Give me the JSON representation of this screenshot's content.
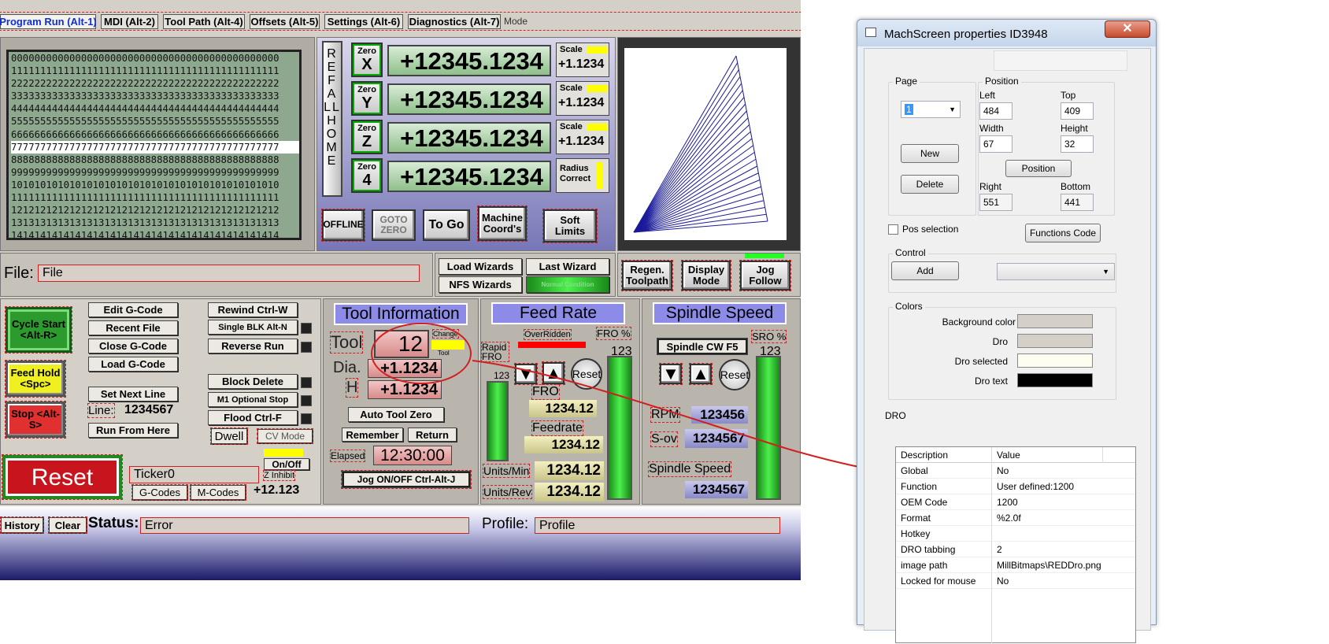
{
  "tabs": [
    {
      "label": "Program Run (Alt-1)",
      "active": true
    },
    {
      "label": "MDI (Alt-2)"
    },
    {
      "label": "Tool Path (Alt-4)"
    },
    {
      "label": "Offsets (Alt-5)"
    },
    {
      "label": "Settings (Alt-6)"
    },
    {
      "label": "Diagnostics (Alt-7)"
    }
  ],
  "mode_label": "Mode",
  "gcode_lines": [
    "0000000000000000000000000000000000000000000000",
    "1111111111111111111111111111111111111111111111",
    "2222222222222222222222222222222222222222222222",
    "3333333333333333333333333333333333333333333333",
    "4444444444444444444444444444444444444444444444",
    "5555555555555555555555555555555555555555555555",
    "6666666666666666666666666666666666666666666666",
    "7777777777777777777777777777777777777777777777",
    "8888888888888888888888888888888888888888888888",
    "9999999999999999999999999999999999999999999999",
    "1010101010101010101010101010101010101010101010",
    "1111111111111111111111111111111111111111111111",
    "1212121212121212121212121212121212121212121212",
    "1313131313131313131313131313131313131313131313",
    "1414141414141414141414141414141414141414141414"
  ],
  "ref_all_home": "REF ALL HOME",
  "axes": [
    {
      "zero": "Zero",
      "axis": "X",
      "value": "+12345.1234",
      "scale_label": "Scale",
      "scale": "+1.1234"
    },
    {
      "zero": "Zero",
      "axis": "Y",
      "value": "+12345.1234",
      "scale_label": "Scale",
      "scale": "+1.1234"
    },
    {
      "zero": "Zero",
      "axis": "Z",
      "value": "+12345.1234",
      "scale_label": "Scale",
      "scale": "+1.1234"
    },
    {
      "zero": "Zero",
      "axis": "4",
      "value": "+12345.1234",
      "scale_label": "Radius Correct"
    }
  ],
  "dro_buttons": {
    "offline": "OFFLINE",
    "goto_zero": "GOTO ZERO",
    "to_go": "To Go",
    "machine_coords": "Machine Coord's",
    "soft_limits": "Soft Limits"
  },
  "file": {
    "label": "File:",
    "value": "File"
  },
  "wizards": {
    "load": "Load Wizards",
    "last": "Last Wizard",
    "nfs": "NFS Wizards",
    "normal": "Normal Condition"
  },
  "toolpath_btns": {
    "regen": "Regen. Toolpath",
    "display": "Display Mode",
    "jog": "Jog Follow"
  },
  "controls": {
    "cycle_start": "Cycle Start <Alt-R>",
    "feed_hold": "Feed Hold <Spc>",
    "stop": "Stop <Alt-S>",
    "reset": "Reset"
  },
  "program_btns": {
    "edit": "Edit G-Code",
    "recent": "Recent File",
    "close": "Close G-Code",
    "load": "Load G-Code",
    "set_next": "Set Next Line",
    "line_label": "Line:",
    "line_value": "1234567",
    "run_from": "Run From Here"
  },
  "program_btns2": {
    "rewind": "Rewind Ctrl-W",
    "single": "Single BLK Alt-N",
    "reverse": "Reverse Run",
    "block_delete": "Block Delete",
    "m1": "M1 Optional Stop",
    "flood": "Flood Ctrl-F",
    "dwell": "Dwell",
    "cv_mode": "CV Mode"
  },
  "ticker": "Ticker0",
  "onoff": "On/Off",
  "z_inhibit": "Z Inhibit",
  "gcodes": "G-Codes",
  "mcodes": "M-Codes",
  "z_value": "+12.123",
  "tool": {
    "header": "Tool Information",
    "tool_label": "Tool",
    "tool_value": "12",
    "change": "Change",
    "tool_small": "Tool",
    "dia_label": "Dia.",
    "dia": "+1.1234",
    "h_label": "H",
    "h": "+1.1234",
    "auto_zero": "Auto Tool Zero",
    "remember": "Remember",
    "return": "Return",
    "elapsed_label": "Elapsed",
    "elapsed": "12:30:00",
    "jog": "Jog ON/OFF Ctrl-Alt-J"
  },
  "feed": {
    "header": "Feed Rate",
    "overridden": "OverRidden",
    "fro_pct": "FRO %",
    "rapid": "Rapid",
    "fro_small": "FRO",
    "bar_label": "123",
    "fro_value_label": "123",
    "fro_label": "FRO",
    "fro": "1234.12",
    "feedrate_label": "Feedrate",
    "feedrate": "1234.12",
    "reset": "Reset",
    "units_min_label": "Units/Min",
    "units_min": "1234.12",
    "units_rev_label": "Units/Rev",
    "units_rev": "1234.12"
  },
  "spindle": {
    "header": "Spindle Speed",
    "cw": "Spindle CW F5",
    "sro_pct": "SRO %",
    "sro_value": "123",
    "reset": "Reset",
    "rpm_label": "RPM",
    "rpm": "123456",
    "sov_label": "S-ov",
    "sov": "1234567",
    "speed_label": "Spindle Speed",
    "speed": "1234567"
  },
  "status": {
    "history": "History",
    "clear": "Clear",
    "label": "Status:",
    "value": "Error",
    "profile_label": "Profile:",
    "profile": "Profile"
  },
  "dialog": {
    "title": "MachScreen properties  ID3948",
    "page_label": "Page",
    "page_value": "1",
    "new": "New",
    "delete": "Delete",
    "position_label": "Position",
    "left_label": "Left",
    "left": "484",
    "top_label": "Top",
    "top": "409",
    "width_label": "Width",
    "width": "67",
    "height_label": "Height",
    "height": "32",
    "position_btn": "Position",
    "right_label": "Right",
    "right": "551",
    "bottom_label": "Bottom",
    "bottom": "441",
    "pos_selection": "Pos selection",
    "functions_code": "Functions Code",
    "control_label": "Control",
    "add": "Add",
    "colors_label": "Colors",
    "bg_color": "Background color",
    "dro": "Dro",
    "dro_selected": "Dro selected",
    "dro_text": "Dro text",
    "swatches": {
      "bg": "#d4d0c8",
      "dro": "#d4d0c8",
      "dro_selected": "#fefef0",
      "dro_text": "#000000"
    },
    "dro_section": "DRO",
    "grid_header": {
      "desc": "Description",
      "value": "Value"
    },
    "grid_rows": [
      {
        "k": "Global",
        "v": "No"
      },
      {
        "k": "Function",
        "v": "User defined:1200"
      },
      {
        "k": "OEM Code",
        "v": "1200"
      },
      {
        "k": "Format",
        "v": "%2.0f"
      },
      {
        "k": "Hotkey",
        "v": ""
      },
      {
        "k": "DRO tabbing",
        "v": "2"
      },
      {
        "k": "image path",
        "v": "MillBitmaps\\REDDro.png"
      },
      {
        "k": "Locked for mouse",
        "v": "No"
      }
    ]
  },
  "colors": {
    "accent_red": "#d02020",
    "dro_green": "#8fbf8a",
    "header_blue": "#8c8ce8",
    "led_yellow": "#ffff00",
    "toolpath_line": "#1a1a9a"
  }
}
